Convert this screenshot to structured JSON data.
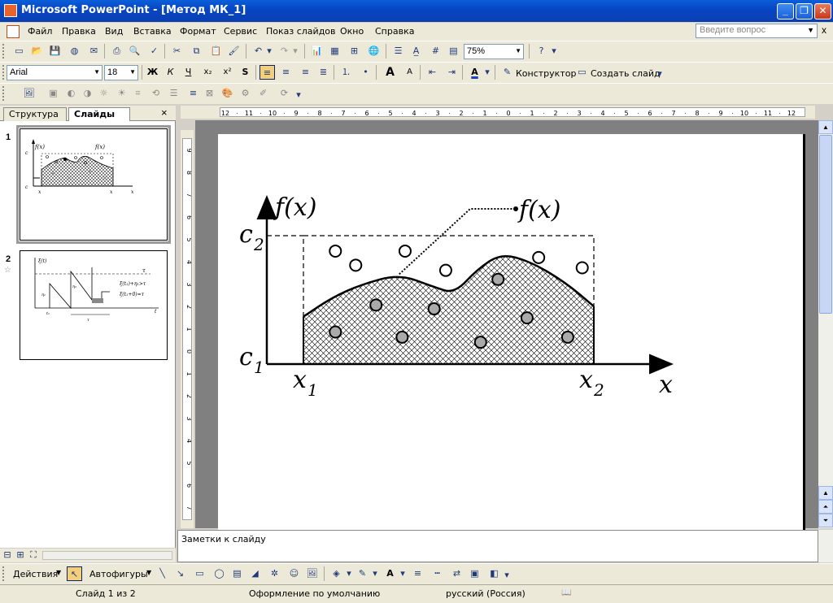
{
  "window": {
    "title": "Microsoft PowerPoint - [Метод МК_1]",
    "minimize": "_",
    "maximize": "❐",
    "close": "✕"
  },
  "menu": {
    "items": [
      "Файл",
      "Правка",
      "Вид",
      "Вставка",
      "Формат",
      "Сервис",
      "Показ слайдов",
      "Окно",
      "Справка"
    ],
    "help_placeholder": "Введите вопрос",
    "doc_close": "x"
  },
  "standard_toolbar": {
    "zoom": "75%"
  },
  "format_toolbar": {
    "font": "Arial",
    "size": "18",
    "bold": "Ж",
    "italic": "К",
    "underline": "Ч",
    "subscript": "x₂",
    "superscript": "x²",
    "shadow": "S",
    "grow_font": "A",
    "shrink_font": "A",
    "font_color": "A",
    "designer": "Конструктор",
    "new_slide": "Создать слайд"
  },
  "left_pane": {
    "tabs": [
      "Структура",
      "Слайды"
    ],
    "active_tab": "Слайды",
    "close": "×",
    "slides": [
      {
        "number": "1"
      },
      {
        "number": "2"
      }
    ]
  },
  "ruler": {
    "h_ticks": [
      "12",
      "11",
      "10",
      "9",
      "8",
      "7",
      "6",
      "5",
      "4",
      "3",
      "2",
      "1",
      "0",
      "1",
      "2",
      "3",
      "4",
      "5",
      "6",
      "7",
      "8",
      "9",
      "10",
      "11",
      "12"
    ],
    "v_ticks": [
      "9",
      "8",
      "7",
      "6",
      "5",
      "4",
      "3",
      "2",
      "1",
      "0",
      "1",
      "2",
      "3",
      "4",
      "5",
      "6",
      "7"
    ]
  },
  "slide": {
    "labels": {
      "y_axis": "f(x)",
      "curve": "f(x)",
      "c2": "c",
      "c2_sub": "2",
      "c1": "c",
      "c1_sub": "1",
      "x1": "x",
      "x1_sub": "1",
      "x2": "x",
      "x2_sub": "2",
      "x_axis": "x"
    }
  },
  "thumb2": {
    "labels": [
      "ξ(t)",
      "ξ(t₁)+η₁>τ",
      "ξ(t₁+0)=τ",
      "τ",
      "t",
      "t₁",
      "τ",
      "η₁",
      "η₂"
    ]
  },
  "notes": {
    "placeholder": "Заметки к слайду"
  },
  "draw_toolbar": {
    "actions": "Действия",
    "autoshapes": "Автофигуры"
  },
  "status": {
    "slide": "Слайд 1 из 2",
    "design": "Оформление по умолчанию",
    "language": "русский (Россия)"
  },
  "colors": {
    "title_bar": "#0a4fd0",
    "chrome": "#ece9d8",
    "hatch": "#000000",
    "filled_point": "#aaaaaa"
  },
  "chart_data": {
    "type": "scatter",
    "title": "",
    "xlabel": "x",
    "ylabel": "f(x)",
    "annotations": [
      "f(x)",
      "c1",
      "c2",
      "x1",
      "x2"
    ],
    "series": [
      {
        "name": "",
        "points": [
          [
            0.11,
            0.88
          ],
          [
            0.18,
            0.77
          ],
          [
            0.35,
            0.88
          ],
          [
            0.49,
            0.73
          ],
          [
            0.81,
            0.83
          ],
          [
            0.96,
            0.75
          ]
        ]
      },
      {
        "name": "",
        "points": [
          [
            0.11,
            0.25
          ],
          [
            0.25,
            0.46
          ],
          [
            0.34,
            0.21
          ],
          [
            0.45,
            0.43
          ],
          [
            0.61,
            0.17
          ],
          [
            0.67,
            0.66
          ],
          [
            0.77,
            0.36
          ],
          [
            0.91,
            0.21
          ]
        ]
      }
    ],
    "curve": {
      "points": [
        [
          0,
          0.37
        ],
        [
          0.1,
          0.52
        ],
        [
          0.2,
          0.62
        ],
        [
          0.33,
          0.7
        ],
        [
          0.45,
          0.6
        ],
        [
          0.52,
          0.55
        ],
        [
          0.6,
          0.74
        ],
        [
          0.68,
          0.86
        ],
        [
          0.78,
          0.8
        ],
        [
          0.9,
          0.64
        ],
        [
          1.0,
          0.45
        ]
      ]
    },
    "xlim": [
      0,
      1
    ],
    "ylim": [
      0,
      1
    ],
    "grid": false
  }
}
